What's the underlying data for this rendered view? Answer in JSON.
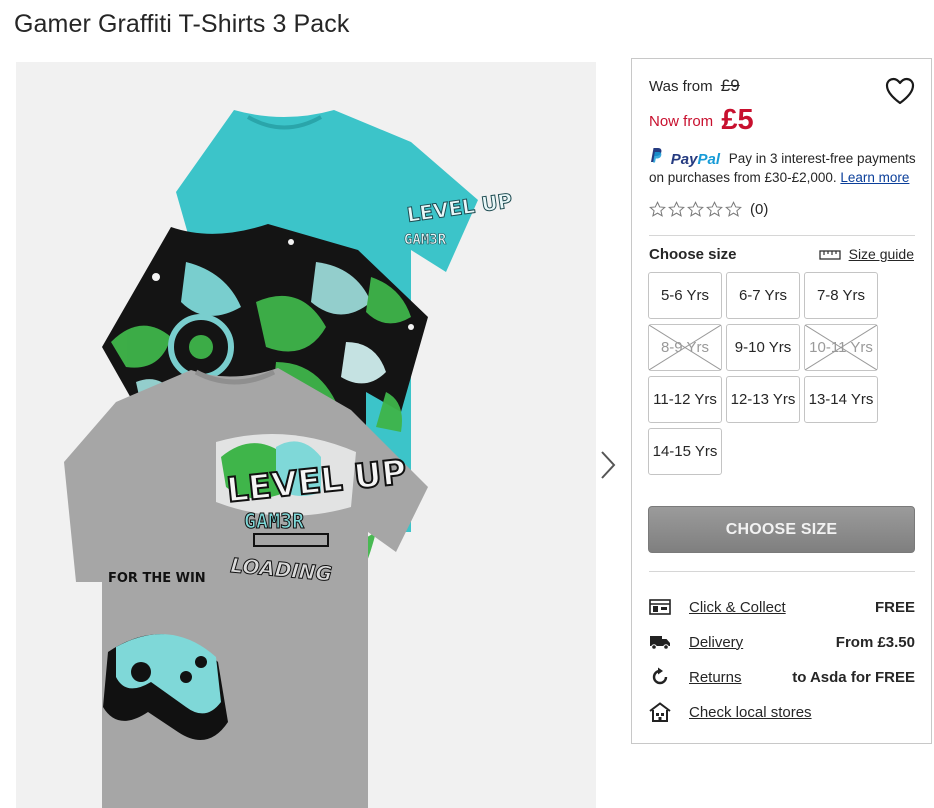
{
  "product": {
    "title": "Gamer Graffiti T-Shirts 3 Pack"
  },
  "pricing": {
    "was_label": "Was from",
    "was_price": "£9",
    "now_label": "Now from",
    "now_price": "£5",
    "sale_color": "#c8102e"
  },
  "wishlist": {
    "icon": "heart-icon"
  },
  "paypal": {
    "brand_part1": "Pay",
    "brand_part2": "Pal",
    "text": "Pay in 3 interest-free payments on purchases from £30-£2,000.",
    "link": "Learn more"
  },
  "rating": {
    "stars_filled": 0,
    "stars_total": 5,
    "count": "(0)"
  },
  "size_selector": {
    "label": "Choose size",
    "guide": "Size guide",
    "options": [
      {
        "label": "5-6 Yrs",
        "available": true
      },
      {
        "label": "6-7 Yrs",
        "available": true
      },
      {
        "label": "7-8 Yrs",
        "available": true
      },
      {
        "label": "8-9 Yrs",
        "available": false
      },
      {
        "label": "9-10 Yrs",
        "available": true
      },
      {
        "label": "10-11 Yrs",
        "available": false
      },
      {
        "label": "11-12 Yrs",
        "available": true
      },
      {
        "label": "12-13 Yrs",
        "available": true
      },
      {
        "label": "13-14 Yrs",
        "available": true
      },
      {
        "label": "14-15 Yrs",
        "available": true
      }
    ]
  },
  "cta": {
    "label": "CHOOSE SIZE"
  },
  "services": [
    {
      "icon": "store-icon",
      "link": "Click & Collect",
      "value": "FREE"
    },
    {
      "icon": "truck-icon",
      "link": "Delivery",
      "value": "From £3.50"
    },
    {
      "icon": "returns-icon",
      "link": "Returns",
      "value": "to Asda for FREE"
    },
    {
      "icon": "local-store-icon",
      "link": "Check local stores",
      "value": ""
    }
  ],
  "image": {
    "shirt_graphic_text": "LEVEL UP",
    "shirt_graphic_sub": "GAM3R",
    "shirt_graphic_loading": "LOADING",
    "shirt_graphic_side": "FOR THE WIN",
    "colors": {
      "teal": "#3cc4c9",
      "grey": "#a6a6a6",
      "camo_green": "#3fb54a",
      "black": "#111111"
    }
  }
}
